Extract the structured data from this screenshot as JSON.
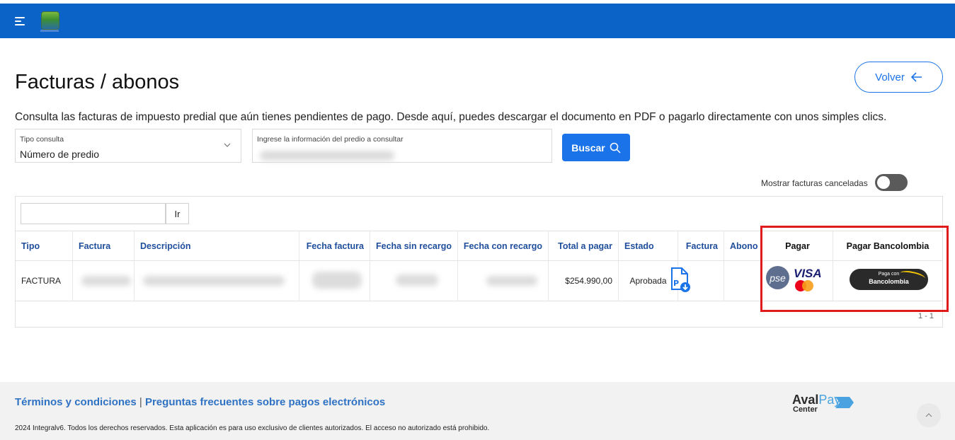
{
  "header": {
    "menu_icon": "hamburger-menu-icon",
    "logo": "app-logo",
    "brand_color": "#0b63c8"
  },
  "page": {
    "title": "Facturas / abonos",
    "back_label": "Volver",
    "intro": "Consulta las facturas de impuesto predial que aún tienes pendientes de pago. Desde aquí, puedes descargar el documento en PDF o pagarlo directamente con unos simples clics."
  },
  "search": {
    "tipo_label": "Tipo consulta",
    "tipo_value": "Número de predio",
    "info_label": "Ingrese la información del predio a consultar",
    "button_label": "Buscar"
  },
  "toggle": {
    "label": "Mostrar facturas canceladas",
    "checked": false
  },
  "table": {
    "go_label": "Ir",
    "columns": [
      "Tipo",
      "Factura",
      "Descripción",
      "Fecha factura",
      "Fecha sin recargo",
      "Fecha con recargo",
      "Total a pagar",
      "Estado",
      "Factura",
      "Abono",
      "Pagar",
      "Pagar Bancolombia"
    ],
    "rows": [
      {
        "tipo": "FACTURA",
        "total": "$254.990,00",
        "estado": "Aprobada",
        "factura_icon": "pdf-download-icon"
      }
    ],
    "pager": "1 - 1"
  },
  "payments": {
    "pse_label": "pse",
    "visa_label": "VISA",
    "bancolombia_small": "Paga con",
    "bancolombia_big": "Bancolombia"
  },
  "footer": {
    "terms": "Términos y condiciones",
    "separator": "|",
    "faq": "Preguntas frecuentes sobre pagos electrónicos",
    "copyright": "2024 Integralv6. Todos los derechos reservados. Esta aplicación es para uso exclusivo de clientes autorizados. El acceso no autorizado está prohibido.",
    "brand_a": "Aval",
    "brand_b": "Pay",
    "brand_c": "Center"
  }
}
